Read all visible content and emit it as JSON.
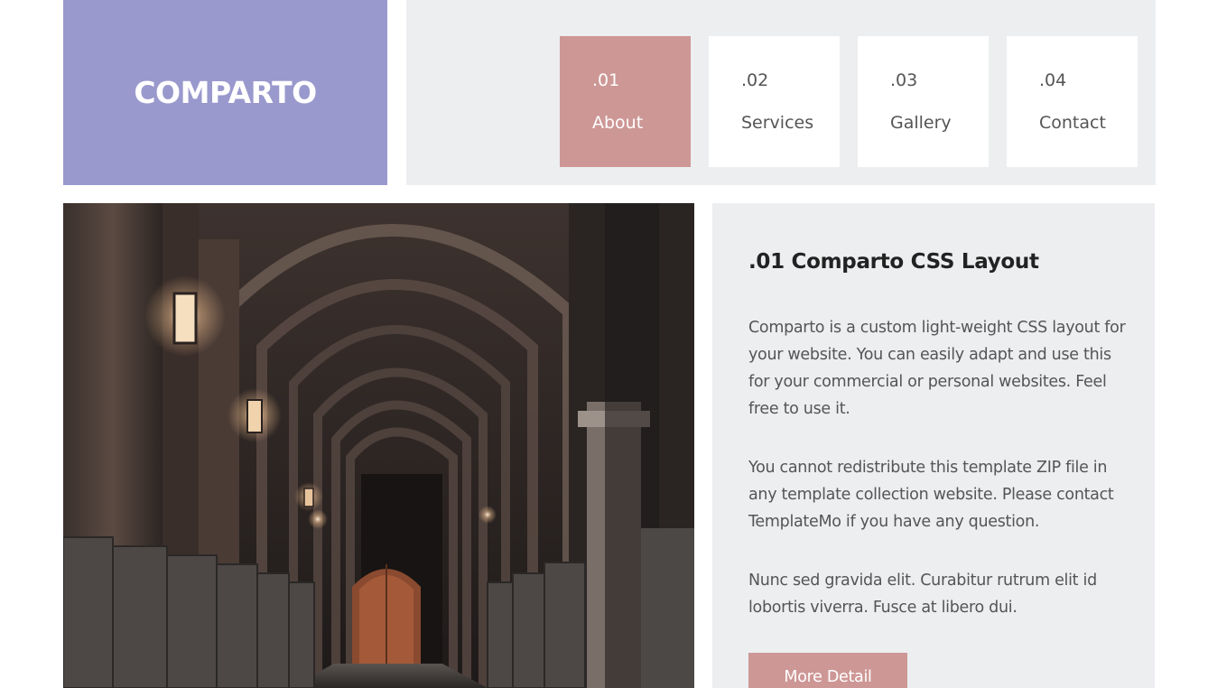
{
  "header": {
    "brand": "COMPARTO",
    "nav": [
      {
        "number": ".01",
        "label": "About",
        "active": true
      },
      {
        "number": ".02",
        "label": "Services",
        "active": false
      },
      {
        "number": ".03",
        "label": "Gallery",
        "active": false
      },
      {
        "number": ".04",
        "label": "Contact",
        "active": false
      }
    ]
  },
  "main": {
    "title": ".01 Comparto CSS Layout",
    "paragraphs": [
      "Comparto is a custom light-weight CSS layout for your website. You can easily adapt and use this for your commercial or personal websites. Feel free to use it.",
      "You cannot redistribute this template ZIP file in any template collection website. Please contact TemplateMo if you have any question.",
      "Nunc sed gravida elit. Curabitur rutrum elit id lobortis viverra. Fusce at libero dui."
    ],
    "button_label": "More Detail"
  },
  "colors": {
    "brand_bg": "#9a99cd",
    "accent": "#cd9795",
    "panel_bg": "#eceef0"
  }
}
